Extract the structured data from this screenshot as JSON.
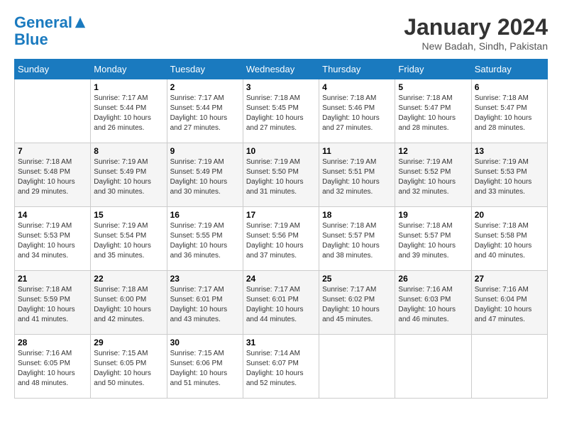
{
  "header": {
    "logo_line1": "General",
    "logo_line2": "Blue",
    "month_year": "January 2024",
    "location": "New Badah, Sindh, Pakistan"
  },
  "days_of_week": [
    "Sunday",
    "Monday",
    "Tuesday",
    "Wednesday",
    "Thursday",
    "Friday",
    "Saturday"
  ],
  "weeks": [
    [
      {
        "day": "",
        "sunrise": "",
        "sunset": "",
        "daylight": ""
      },
      {
        "day": "1",
        "sunrise": "Sunrise: 7:17 AM",
        "sunset": "Sunset: 5:44 PM",
        "daylight": "Daylight: 10 hours and 26 minutes."
      },
      {
        "day": "2",
        "sunrise": "Sunrise: 7:17 AM",
        "sunset": "Sunset: 5:44 PM",
        "daylight": "Daylight: 10 hours and 27 minutes."
      },
      {
        "day": "3",
        "sunrise": "Sunrise: 7:18 AM",
        "sunset": "Sunset: 5:45 PM",
        "daylight": "Daylight: 10 hours and 27 minutes."
      },
      {
        "day": "4",
        "sunrise": "Sunrise: 7:18 AM",
        "sunset": "Sunset: 5:46 PM",
        "daylight": "Daylight: 10 hours and 27 minutes."
      },
      {
        "day": "5",
        "sunrise": "Sunrise: 7:18 AM",
        "sunset": "Sunset: 5:47 PM",
        "daylight": "Daylight: 10 hours and 28 minutes."
      },
      {
        "day": "6",
        "sunrise": "Sunrise: 7:18 AM",
        "sunset": "Sunset: 5:47 PM",
        "daylight": "Daylight: 10 hours and 28 minutes."
      }
    ],
    [
      {
        "day": "7",
        "sunrise": "Sunrise: 7:18 AM",
        "sunset": "Sunset: 5:48 PM",
        "daylight": "Daylight: 10 hours and 29 minutes."
      },
      {
        "day": "8",
        "sunrise": "Sunrise: 7:19 AM",
        "sunset": "Sunset: 5:49 PM",
        "daylight": "Daylight: 10 hours and 30 minutes."
      },
      {
        "day": "9",
        "sunrise": "Sunrise: 7:19 AM",
        "sunset": "Sunset: 5:49 PM",
        "daylight": "Daylight: 10 hours and 30 minutes."
      },
      {
        "day": "10",
        "sunrise": "Sunrise: 7:19 AM",
        "sunset": "Sunset: 5:50 PM",
        "daylight": "Daylight: 10 hours and 31 minutes."
      },
      {
        "day": "11",
        "sunrise": "Sunrise: 7:19 AM",
        "sunset": "Sunset: 5:51 PM",
        "daylight": "Daylight: 10 hours and 32 minutes."
      },
      {
        "day": "12",
        "sunrise": "Sunrise: 7:19 AM",
        "sunset": "Sunset: 5:52 PM",
        "daylight": "Daylight: 10 hours and 32 minutes."
      },
      {
        "day": "13",
        "sunrise": "Sunrise: 7:19 AM",
        "sunset": "Sunset: 5:53 PM",
        "daylight": "Daylight: 10 hours and 33 minutes."
      }
    ],
    [
      {
        "day": "14",
        "sunrise": "Sunrise: 7:19 AM",
        "sunset": "Sunset: 5:53 PM",
        "daylight": "Daylight: 10 hours and 34 minutes."
      },
      {
        "day": "15",
        "sunrise": "Sunrise: 7:19 AM",
        "sunset": "Sunset: 5:54 PM",
        "daylight": "Daylight: 10 hours and 35 minutes."
      },
      {
        "day": "16",
        "sunrise": "Sunrise: 7:19 AM",
        "sunset": "Sunset: 5:55 PM",
        "daylight": "Daylight: 10 hours and 36 minutes."
      },
      {
        "day": "17",
        "sunrise": "Sunrise: 7:19 AM",
        "sunset": "Sunset: 5:56 PM",
        "daylight": "Daylight: 10 hours and 37 minutes."
      },
      {
        "day": "18",
        "sunrise": "Sunrise: 7:18 AM",
        "sunset": "Sunset: 5:57 PM",
        "daylight": "Daylight: 10 hours and 38 minutes."
      },
      {
        "day": "19",
        "sunrise": "Sunrise: 7:18 AM",
        "sunset": "Sunset: 5:57 PM",
        "daylight": "Daylight: 10 hours and 39 minutes."
      },
      {
        "day": "20",
        "sunrise": "Sunrise: 7:18 AM",
        "sunset": "Sunset: 5:58 PM",
        "daylight": "Daylight: 10 hours and 40 minutes."
      }
    ],
    [
      {
        "day": "21",
        "sunrise": "Sunrise: 7:18 AM",
        "sunset": "Sunset: 5:59 PM",
        "daylight": "Daylight: 10 hours and 41 minutes."
      },
      {
        "day": "22",
        "sunrise": "Sunrise: 7:18 AM",
        "sunset": "Sunset: 6:00 PM",
        "daylight": "Daylight: 10 hours and 42 minutes."
      },
      {
        "day": "23",
        "sunrise": "Sunrise: 7:17 AM",
        "sunset": "Sunset: 6:01 PM",
        "daylight": "Daylight: 10 hours and 43 minutes."
      },
      {
        "day": "24",
        "sunrise": "Sunrise: 7:17 AM",
        "sunset": "Sunset: 6:01 PM",
        "daylight": "Daylight: 10 hours and 44 minutes."
      },
      {
        "day": "25",
        "sunrise": "Sunrise: 7:17 AM",
        "sunset": "Sunset: 6:02 PM",
        "daylight": "Daylight: 10 hours and 45 minutes."
      },
      {
        "day": "26",
        "sunrise": "Sunrise: 7:16 AM",
        "sunset": "Sunset: 6:03 PM",
        "daylight": "Daylight: 10 hours and 46 minutes."
      },
      {
        "day": "27",
        "sunrise": "Sunrise: 7:16 AM",
        "sunset": "Sunset: 6:04 PM",
        "daylight": "Daylight: 10 hours and 47 minutes."
      }
    ],
    [
      {
        "day": "28",
        "sunrise": "Sunrise: 7:16 AM",
        "sunset": "Sunset: 6:05 PM",
        "daylight": "Daylight: 10 hours and 48 minutes."
      },
      {
        "day": "29",
        "sunrise": "Sunrise: 7:15 AM",
        "sunset": "Sunset: 6:05 PM",
        "daylight": "Daylight: 10 hours and 50 minutes."
      },
      {
        "day": "30",
        "sunrise": "Sunrise: 7:15 AM",
        "sunset": "Sunset: 6:06 PM",
        "daylight": "Daylight: 10 hours and 51 minutes."
      },
      {
        "day": "31",
        "sunrise": "Sunrise: 7:14 AM",
        "sunset": "Sunset: 6:07 PM",
        "daylight": "Daylight: 10 hours and 52 minutes."
      },
      {
        "day": "",
        "sunrise": "",
        "sunset": "",
        "daylight": ""
      },
      {
        "day": "",
        "sunrise": "",
        "sunset": "",
        "daylight": ""
      },
      {
        "day": "",
        "sunrise": "",
        "sunset": "",
        "daylight": ""
      }
    ]
  ]
}
